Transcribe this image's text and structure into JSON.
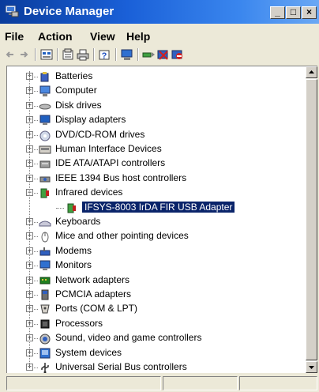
{
  "window": {
    "title": "Device Manager"
  },
  "title_buttons": [
    "_",
    "□",
    "×"
  ],
  "menu": [
    "File",
    "Action",
    "View",
    "Help"
  ],
  "toolbar": {
    "buttons": [
      "back-icon",
      "forward-icon",
      "view-icon",
      "properties-icon",
      "print-icon",
      "help-icon",
      "computer-icon",
      "scan-hardware-icon",
      "uninstall-icon",
      "disable-icon"
    ]
  },
  "tree": {
    "items": [
      {
        "label": "Batteries",
        "icon": "battery-icon",
        "expander": "+"
      },
      {
        "label": "Computer",
        "icon": "computer-icon",
        "expander": "+"
      },
      {
        "label": "Disk drives",
        "icon": "disk-drive-icon",
        "expander": "+"
      },
      {
        "label": "Display adapters",
        "icon": "display-icon",
        "expander": "+"
      },
      {
        "label": "DVD/CD-ROM drives",
        "icon": "dvd-icon",
        "expander": "+"
      },
      {
        "label": "Human Interface Devices",
        "icon": "hid-icon",
        "expander": "+"
      },
      {
        "label": "IDE ATA/ATAPI controllers",
        "icon": "ide-icon",
        "expander": "+"
      },
      {
        "label": "IEEE 1394 Bus host controllers",
        "icon": "ieee1394-icon",
        "expander": "+"
      },
      {
        "label": "Infrared devices",
        "icon": "infrared-icon",
        "expander": "−"
      },
      {
        "label": "IFSYS-8003 IrDA FIR USB Adapter",
        "icon": "infrared-icon",
        "expander": "",
        "child": true,
        "selected": true
      },
      {
        "label": "Keyboards",
        "icon": "keyboard-icon",
        "expander": "+"
      },
      {
        "label": "Mice and other pointing devices",
        "icon": "mouse-icon",
        "expander": "+"
      },
      {
        "label": "Modems",
        "icon": "modem-icon",
        "expander": "+"
      },
      {
        "label": "Monitors",
        "icon": "monitor-icon",
        "expander": "+"
      },
      {
        "label": "Network adapters",
        "icon": "network-icon",
        "expander": "+"
      },
      {
        "label": "PCMCIA adapters",
        "icon": "pcmcia-icon",
        "expander": "+"
      },
      {
        "label": "Ports (COM & LPT)",
        "icon": "port-icon",
        "expander": "+"
      },
      {
        "label": "Processors",
        "icon": "processor-icon",
        "expander": "+"
      },
      {
        "label": "Sound, video and game controllers",
        "icon": "sound-icon",
        "expander": "+"
      },
      {
        "label": "System devices",
        "icon": "system-icon",
        "expander": "+"
      },
      {
        "label": "Universal Serial Bus controllers",
        "icon": "usb-icon",
        "expander": "+"
      }
    ]
  },
  "colors": {
    "title_start": "#0a3c9c",
    "title_end": "#6aa8f4",
    "selection": "#0a246a",
    "chrome": "#ece9d8"
  }
}
